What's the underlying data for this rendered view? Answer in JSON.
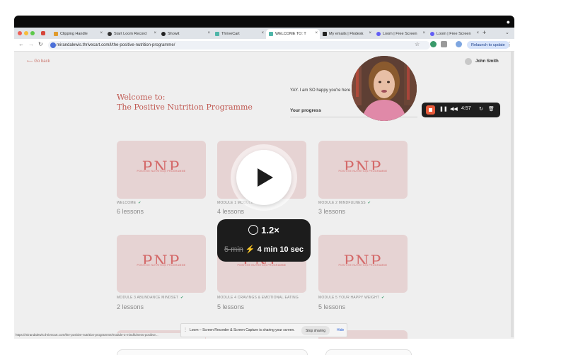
{
  "browser": {
    "tabs": [
      {
        "label": "Clipping Handle",
        "fav_color": "#e09b2d",
        "active": false
      },
      {
        "label": "Start Loom Record",
        "fav_color": "#333333",
        "active": false
      },
      {
        "label": "Showit",
        "fav_color": "#222222",
        "active": false
      },
      {
        "label": "ThriveCart",
        "fav_color": "#4fb5a8",
        "active": false
      },
      {
        "label": "WELCOME TO: T",
        "fav_color": "#4fb5a8",
        "active": true
      },
      {
        "label": "My emails | Flodesk",
        "fav_color": "#222222",
        "active": false
      },
      {
        "label": "Loom | Free Screen",
        "fav_color": "#625df5",
        "active": false
      },
      {
        "label": "Loom | Free Screen",
        "fav_color": "#625df5",
        "active": false
      }
    ],
    "url": "mirandalewis.thrivecart.com/l/the-positive-nutrition-programme/",
    "relaunch_label": "Relaunch to update"
  },
  "page": {
    "go_back": "Go back",
    "user_name": "John Smith",
    "welcome_line1": "Welcome to:",
    "welcome_line2": "The Positive Nutrition Programme",
    "yay_text": "YAY. I am SO happy you're here",
    "progress_label": "Your progress"
  },
  "modules": [
    {
      "label": "WELCOME",
      "lessons": "6 lessons"
    },
    {
      "label": "MODULE 1 MODULE",
      "lessons": "4 lessons"
    },
    {
      "label": "MODULE 2 MINDFULNESS",
      "lessons": "3 lessons"
    },
    {
      "label": "MODULE 3 ABUNDANCE MINDSET",
      "lessons": "2 lessons"
    },
    {
      "label": "MODULE 4 CRAVINGS & EMOTIONAL EATING",
      "lessons": "5 lessons"
    },
    {
      "label": "MODULE 5 YOUR HAPPY WEIGHT",
      "lessons": "5 lessons"
    }
  ],
  "card_logo": {
    "letters": "PNP",
    "subtitle": "POSITIVE NUTRITION PROGRAMME"
  },
  "player": {
    "speed": "1.2×",
    "original_time": "5 min",
    "new_time": "4 min 10 sec"
  },
  "recorder": {
    "timer": "4:57"
  },
  "share_bar": {
    "message": "Loom – Screen Recorder & Screen Capture is sharing your screen.",
    "stop_label": "Stop sharing",
    "hide_label": "Hide"
  },
  "status_url": "https://mirandalewis.thrivecart.com/the-positive-nutrition-programme/module-2-mindfulness-positive..."
}
